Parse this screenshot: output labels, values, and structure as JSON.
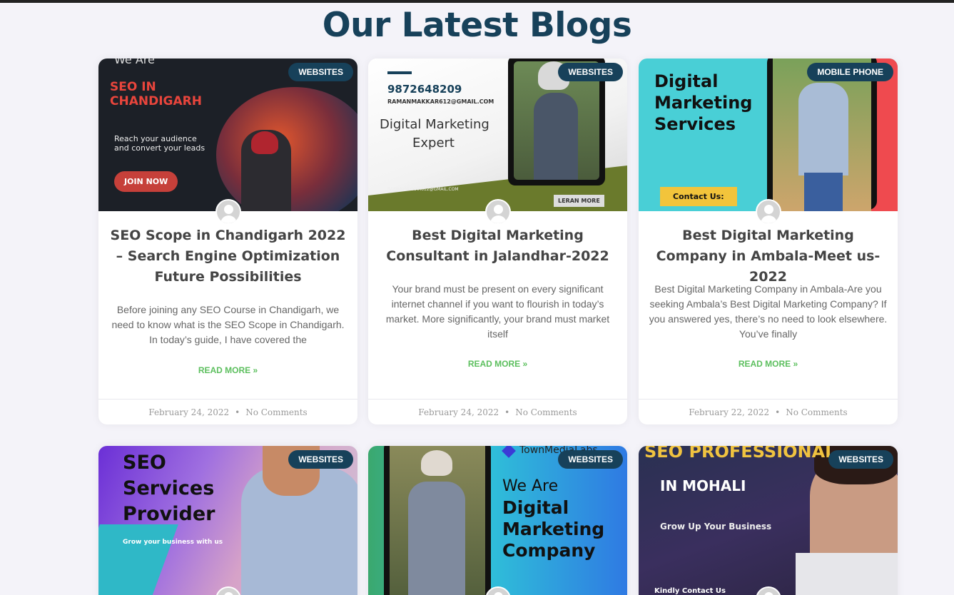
{
  "section": {
    "title": "Our Latest Blogs"
  },
  "colors": {
    "heading": "#17415a",
    "badge": "#17415a",
    "read_more": "#5cbf5e"
  },
  "posts": [
    {
      "category": "WEBSITES",
      "title": "SEO Scope in Chandigarh 2022 – Search Engine Optimization Future Possibilities",
      "excerpt": "Before joining any SEO Course in Chandigarh, we need to know what is the SEO Scope in Chandigarh. In today’s guide, I have covered the",
      "read_more": "READ MORE »",
      "date": "February 24, 2022",
      "comments": "No Comments",
      "image": {
        "line1": "We Are",
        "line2": "SEO IN",
        "line3": "CHANDIGARH",
        "line4": "Reach your audience",
        "line5": "and convert your leads",
        "button": "JOIN NOW"
      }
    },
    {
      "category": "WEBSITES",
      "title": "Best Digital Marketing Consultant in Jalandhar-2022",
      "excerpt": "Your brand must be present on every significant internet channel if you want to flourish in today’s market. More significantly, your brand must market itself",
      "read_more": "READ MORE »",
      "date": "February 24, 2022",
      "comments": "No Comments",
      "image": {
        "phone": "9872648209",
        "email": "RAMANMAKKAR612@GMAIL.COM",
        "line1": "Digital Marketing",
        "line2": "Expert",
        "email_small": "RAMANMAKKAR612@GMAIL.COM",
        "button": "LERAN MORE"
      }
    },
    {
      "category": "MOBILE PHONE",
      "title": "Best Digital Marketing Company in Ambala-Meet us-2022",
      "excerpt": "Best Digital Marketing Company in Ambala-Are you seeking Ambala’s Best Digital Marketing Company? If you answered yes, there’s no need to look elsewhere. You’ve finally",
      "read_more": "READ MORE »",
      "date": "February 22, 2022",
      "comments": "No Comments",
      "image": {
        "line1": "Digital",
        "line2": "Marketing",
        "line3": "Services",
        "button": "Contact Us:"
      }
    },
    {
      "category": "WEBSITES",
      "image": {
        "line1": "SEO",
        "line2": "Services",
        "line3": "Provider",
        "line4": "Grow your business with us"
      }
    },
    {
      "category": "WEBSITES",
      "image": {
        "brand": "TownMediaLabs",
        "line1": "We Are",
        "line2": "Digital",
        "line3": "Marketing",
        "line4": "Company"
      }
    },
    {
      "category": "WEBSITES",
      "image": {
        "line1": "SEO PROFESSIONAL",
        "line2": "IN MOHALI",
        "line3": "Grow Up Your Business",
        "line4": "Kindly Contact Us"
      }
    }
  ]
}
